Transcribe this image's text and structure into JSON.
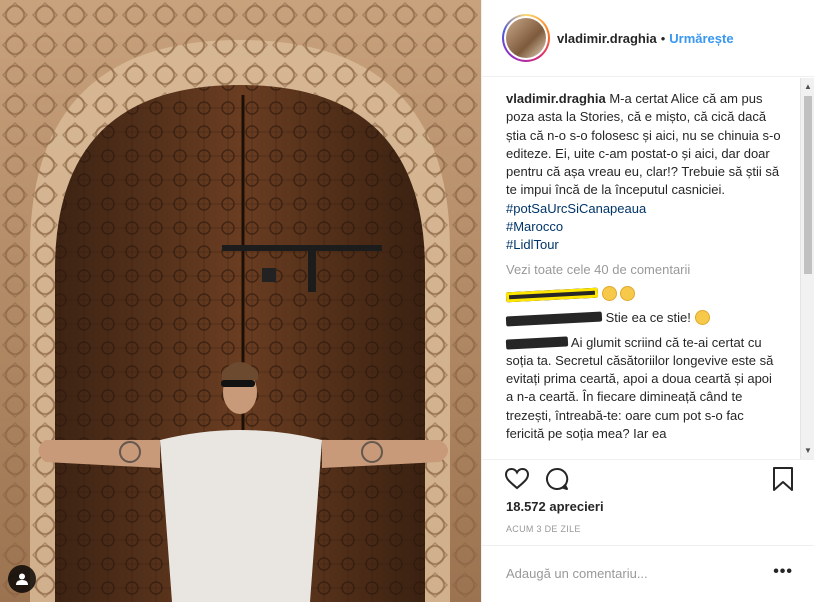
{
  "post": {
    "username": "vladimir.draghia",
    "separator": "•",
    "follow_label": "Urmărește",
    "caption_username": "vladimir.draghia",
    "caption_text": "M-a certat Alice că am pus poza asta la Stories, că e mișto, că cică dacă știa că n-o s-o folosesc și aici, nu se chinuia s-o editeze. Ei, uite c-am postat-o și aici, dar doar pentru că așa vreau eu, clar!? Trebuie să știi să te impui încă de la începutul casniciei.",
    "hashtags": [
      "#potSaUrcSiCanapeaua",
      "#Marocco",
      "#LidlTour"
    ],
    "view_all": "Vezi toate cele 40 de comentarii",
    "comments": [
      {
        "text": ""
      },
      {
        "text": " Stie ea ce stie! "
      },
      {
        "text": " Ai glumit scriind că te-ai certat cu soția ta. Secretul căsătoriilor longevive este să evitați prima ceartă, apoi a doua ceartă și apoi a n-a ceartă. În fiecare dimineață când te trezești, întreabă-te: oare cum pot s-o fac fericită pe soția mea? Iar ea"
      }
    ],
    "likes": "18.572 aprecieri",
    "time": "ACUM 3 DE ZILE",
    "add_comment_placeholder": "Adaugă un comentariu...",
    "more_label": "•••"
  },
  "icons": {
    "like": "heart-icon",
    "comment": "comment-icon",
    "save": "bookmark-icon",
    "tag": "user-tag-icon"
  }
}
